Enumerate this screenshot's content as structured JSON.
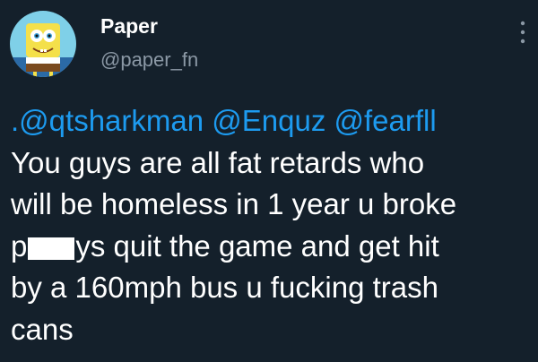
{
  "author": {
    "display_name": "Paper",
    "handle": "@paper_fn",
    "avatar_icon": "spongebob-avatar-icon"
  },
  "tweet": {
    "mentions": {
      "prefix": ".",
      "m1": "@qtsharkman",
      "m2": "@Enquz",
      "m3": "@fearfll"
    },
    "lines": [
      "You guys are all fat retards who",
      "will be homeless in 1 year u broke",
      "p",
      "ys quit the game and get hit",
      "by a 160mph bus u fucking trash",
      "cans"
    ]
  },
  "menu": {
    "icon": "more-options-icon"
  },
  "colors": {
    "background": "#14202b",
    "text": "#ffffff",
    "secondary": "#8b98a5",
    "mention": "#1d9bf0"
  }
}
